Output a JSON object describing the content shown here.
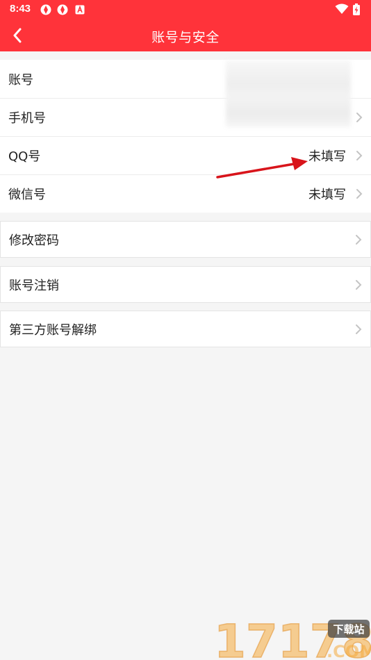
{
  "status_bar": {
    "time": "8:43"
  },
  "header": {
    "title": "账号与安全",
    "back_icon": "chevron-left-icon"
  },
  "account_group": {
    "items": [
      {
        "label": "账号",
        "value": ""
      },
      {
        "label": "手机号",
        "value": ""
      },
      {
        "label": "QQ号",
        "value": "未填写"
      },
      {
        "label": "微信号",
        "value": "未填写"
      }
    ]
  },
  "actions": {
    "change_password": "修改密码",
    "cancel_account": "账号注销",
    "unbind_third_party": "第三方账号解绑"
  },
  "watermark": {
    "number": "17178",
    "suffix": ".COM",
    "badge": "下载站"
  },
  "colors": {
    "brand": "#ff333a",
    "background": "#f5f5f5",
    "annotation_arrow": "#d8141b"
  }
}
